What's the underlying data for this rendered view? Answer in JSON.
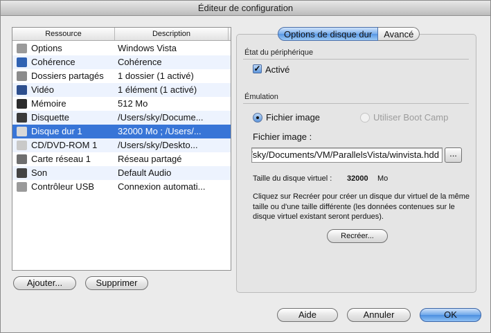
{
  "window": {
    "title": "Éditeur de configuration"
  },
  "resources": {
    "headers": {
      "resource": "Ressource",
      "description": "Description"
    },
    "rows": [
      {
        "name": "Options",
        "desc": "Windows Vista",
        "icon": "gear-icon",
        "color": "#9a9a9a"
      },
      {
        "name": "Cohérence",
        "desc": "Cohérence",
        "icon": "coherence-icon",
        "color": "#2f62b3"
      },
      {
        "name": "Dossiers partagés",
        "desc": "1 dossier (1 activé)",
        "icon": "shared-folder-icon",
        "color": "#8c8c8c"
      },
      {
        "name": "Vidéo",
        "desc": "1 élément (1 activé)",
        "icon": "monitor-icon",
        "color": "#2d4f8e"
      },
      {
        "name": "Mémoire",
        "desc": "512 Mo",
        "icon": "memory-chip-icon",
        "color": "#2b2b2b"
      },
      {
        "name": "Disquette",
        "desc": "/Users/sky/Docume...",
        "icon": "floppy-icon",
        "color": "#3a3a3a"
      },
      {
        "name": "Disque dur 1",
        "desc": "32000 Mo ; /Users/...",
        "icon": "hard-disk-icon",
        "color": "#d8d8d8"
      },
      {
        "name": "CD/DVD-ROM 1",
        "desc": "/Users/sky/Deskto...",
        "icon": "cd-icon",
        "color": "#c9c9c9"
      },
      {
        "name": "Carte réseau 1",
        "desc": "Réseau partagé",
        "icon": "network-card-icon",
        "color": "#6f6f6f"
      },
      {
        "name": "Son",
        "desc": "Default Audio",
        "icon": "speaker-icon",
        "color": "#444444"
      },
      {
        "name": "Contrôleur USB",
        "desc": "Connexion automati...",
        "icon": "usb-icon",
        "color": "#9a9a9a"
      }
    ],
    "selected_index": 6,
    "add_label": "Ajouter...",
    "remove_label": "Supprimer"
  },
  "tabs": [
    {
      "label": "Options de disque dur",
      "active": true
    },
    {
      "label": "Avancé",
      "active": false
    }
  ],
  "device_state": {
    "section": "État du périphérique",
    "enabled_label": "Activé",
    "enabled": true
  },
  "emulation": {
    "section": "Émulation",
    "image_file_option": "Fichier image",
    "boot_camp_option": "Utiliser Boot Camp",
    "image_file_label": "Fichier image :",
    "image_path": "/Users/sky/Documents/VM/ParallelsVista/winvista.hdd",
    "browse_label": "...",
    "virtual_size_label": "Taille du disque virtuel :",
    "virtual_size_value": "32000",
    "virtual_size_unit": "Mo",
    "recreate_info": "Cliquez sur Recréer pour créer un disque dur virtuel de la même taille ou d'une taille différente (les données contenues sur le disque virtuel existant seront perdues).",
    "recreate_label": "Recréer..."
  },
  "footer": {
    "help_label": "Aide",
    "cancel_label": "Annuler",
    "ok_label": "OK"
  },
  "colors": {
    "selection": "#3875d7",
    "accent": "#5897e4"
  }
}
